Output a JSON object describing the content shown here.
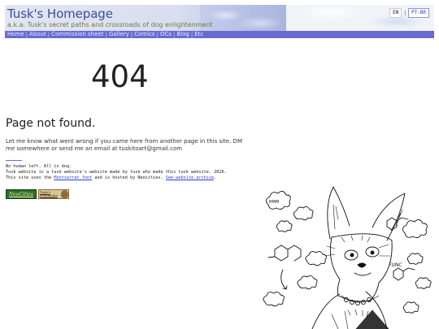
{
  "header": {
    "title": "Tusk's Homepage",
    "subtitle": "a.k.a. Tusk's secret paths and crossroads of dog enlightenment",
    "languages": [
      {
        "code": "EN",
        "active": false
      },
      {
        "code": "PT-BR",
        "active": true
      }
    ],
    "language_separator": "|"
  },
  "nav": {
    "items": [
      {
        "label": "Home"
      },
      {
        "label": "About"
      },
      {
        "label": "Commission sheet"
      },
      {
        "label": "Gallery"
      },
      {
        "label": "Comics"
      },
      {
        "label": "OCs"
      },
      {
        "label": "Blog"
      },
      {
        "label": "Etc"
      }
    ],
    "separator": "|"
  },
  "main": {
    "code": "404",
    "heading": "Page not found.",
    "message": "Let me know what went wrong if you came here from another page in this site. DM me somewhere or send me an email at tuskitoart@gmail.com"
  },
  "footer": {
    "line1": "No human left. All is dog.",
    "line2": "Tusk website is a tusk website's website made by tusk who made this tusk website. 2026.",
    "line3_prefix": "This site uses the ",
    "line3_font_link": "Montserrat font",
    "line3_middle": " and is hosted by Neocities. ",
    "line3_archive_link": "See website archive",
    "line3_suffix": ".",
    "badges": {
      "neocities": "NeoCities",
      "tusk": "Tusk's Homepage"
    }
  },
  "illustration": {
    "bubble_texts": [
      "HMM",
      "FUNC"
    ]
  },
  "colors": {
    "title": "#3a4e97",
    "subtitle": "#6c7a41",
    "nav_bg": "#6a6bd1",
    "link": "#2a3bd0"
  }
}
